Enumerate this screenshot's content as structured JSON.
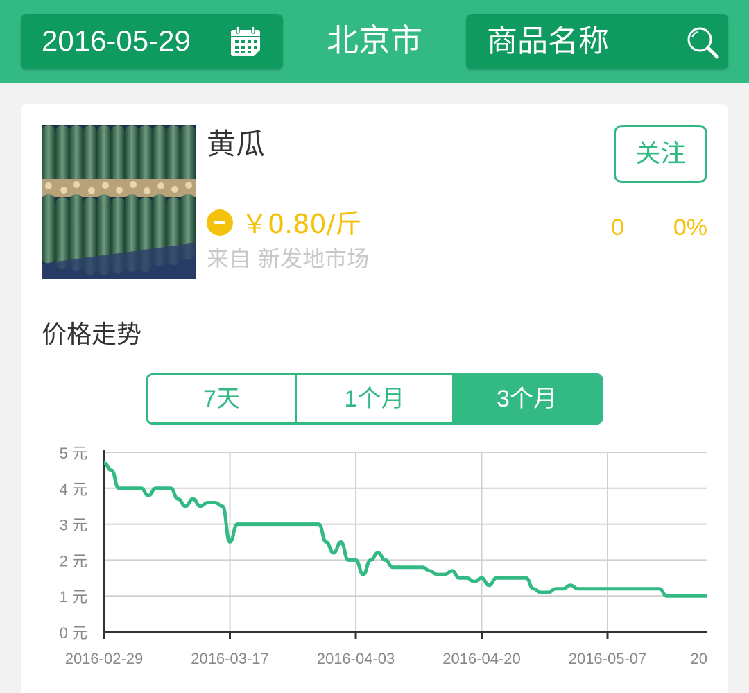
{
  "header": {
    "date": "2016-05-29",
    "calendar_icon": "calendar-icon",
    "city": "北京市",
    "search_placeholder": "商品名称",
    "search_icon": "search-icon",
    "background": "#33b984",
    "box_color": "#0f9a60"
  },
  "product": {
    "image": "cucumber-photo",
    "name": "黄瓜",
    "follow_label": "关注",
    "trend_icon": "minus-circle-icon",
    "price": "￥0.80/斤",
    "source": "来自 新发地市场",
    "change_abs": "0",
    "change_pct": "0%",
    "price_color": "#f4c20d"
  },
  "trend_section": {
    "title": "价格走势",
    "tabs": [
      {
        "label": "7天",
        "selected": false
      },
      {
        "label": "1个月",
        "selected": false
      },
      {
        "label": "3个月",
        "selected": true
      }
    ]
  },
  "chart_data": {
    "type": "line",
    "title": "",
    "xlabel": "",
    "ylabel": "",
    "ylim": [
      0,
      5
    ],
    "y_ticks": [
      "0 元",
      "1 元",
      "2 元",
      "3 元",
      "4 元",
      "5 元"
    ],
    "x_ticks": [
      "2016-02-29",
      "2016-03-17",
      "2016-04-03",
      "2016-04-20",
      "2016-05-07",
      "20"
    ],
    "grid": true,
    "line_color": "#33b984",
    "series": [
      {
        "values": [
          [
            0,
            4.7
          ],
          [
            1,
            4.5
          ],
          [
            2,
            4.0
          ],
          [
            3,
            4.0
          ],
          [
            4,
            4.0
          ],
          [
            5,
            4.0
          ],
          [
            6,
            3.8
          ],
          [
            7,
            4.0
          ],
          [
            8,
            4.0
          ],
          [
            9,
            4.0
          ],
          [
            10,
            3.7
          ],
          [
            11,
            3.5
          ],
          [
            12,
            3.7
          ],
          [
            13,
            3.5
          ],
          [
            14,
            3.6
          ],
          [
            15,
            3.6
          ],
          [
            16,
            3.5
          ],
          [
            17,
            2.5
          ],
          [
            18,
            3.0
          ],
          [
            19,
            3.0
          ],
          [
            20,
            3.0
          ],
          [
            21,
            3.0
          ],
          [
            22,
            3.0
          ],
          [
            23,
            3.0
          ],
          [
            24,
            3.0
          ],
          [
            25,
            3.0
          ],
          [
            26,
            3.0
          ],
          [
            27,
            3.0
          ],
          [
            28,
            3.0
          ],
          [
            29,
            3.0
          ],
          [
            30,
            2.5
          ],
          [
            31,
            2.2
          ],
          [
            32,
            2.5
          ],
          [
            33,
            2.0
          ],
          [
            34,
            2.0
          ],
          [
            35,
            1.6
          ],
          [
            36,
            2.0
          ],
          [
            37,
            2.2
          ],
          [
            38,
            2.0
          ],
          [
            39,
            1.8
          ],
          [
            40,
            1.8
          ],
          [
            41,
            1.8
          ],
          [
            42,
            1.8
          ],
          [
            43,
            1.8
          ],
          [
            44,
            1.7
          ],
          [
            45,
            1.6
          ],
          [
            46,
            1.6
          ],
          [
            47,
            1.7
          ],
          [
            48,
            1.5
          ],
          [
            49,
            1.5
          ],
          [
            50,
            1.4
          ],
          [
            51,
            1.5
          ],
          [
            52,
            1.3
          ],
          [
            53,
            1.5
          ],
          [
            54,
            1.5
          ],
          [
            55,
            1.5
          ],
          [
            56,
            1.5
          ],
          [
            57,
            1.5
          ],
          [
            58,
            1.2
          ],
          [
            59,
            1.1
          ],
          [
            60,
            1.1
          ],
          [
            61,
            1.2
          ],
          [
            62,
            1.2
          ],
          [
            63,
            1.3
          ],
          [
            64,
            1.2
          ],
          [
            65,
            1.2
          ],
          [
            66,
            1.2
          ],
          [
            67,
            1.2
          ],
          [
            68,
            1.2
          ],
          [
            69,
            1.2
          ],
          [
            70,
            1.2
          ],
          [
            71,
            1.2
          ],
          [
            72,
            1.2
          ],
          [
            73,
            1.2
          ],
          [
            74,
            1.2
          ],
          [
            75,
            1.2
          ],
          [
            76,
            1.0
          ],
          [
            77,
            1.0
          ],
          [
            78,
            1.0
          ],
          [
            79,
            1.0
          ],
          [
            80,
            1.0
          ],
          [
            81,
            1.0
          ],
          [
            82,
            1.0
          ],
          [
            83,
            0.9
          ],
          [
            84,
            1.0
          ],
          [
            85,
            1.0
          ]
        ]
      }
    ]
  }
}
